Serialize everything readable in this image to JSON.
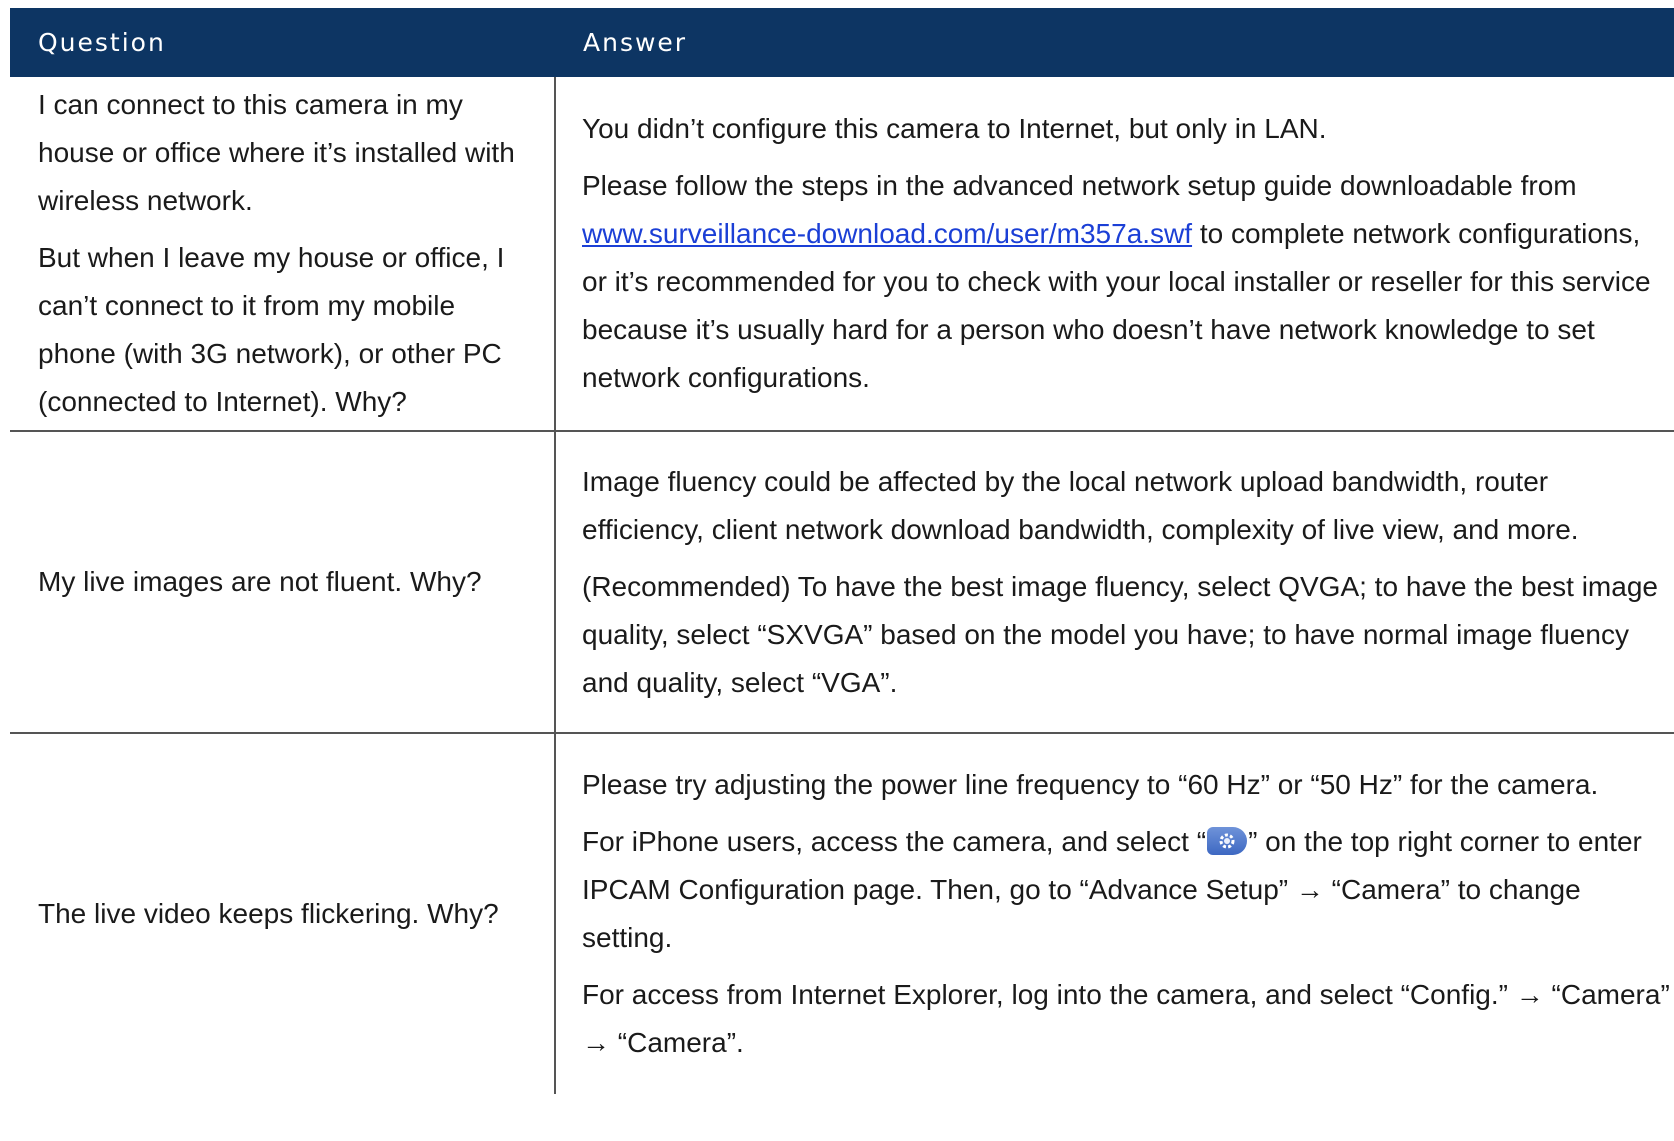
{
  "header": {
    "question": "Question",
    "answer": "Answer"
  },
  "rows": [
    {
      "question": [
        "I can connect to this camera in my house or office where it’s installed with wireless network.",
        "But when I leave my house or office, I can’t connect to it from my mobile phone (with 3G network), or other PC (connected to Internet). Why?"
      ],
      "answer_p1": "You didn’t configure this camera to Internet, but only in LAN.",
      "answer_p2_before": "Please follow the steps in the advanced network setup guide downloadable from ",
      "answer_p2_link": "www.surveillance-download.com/user/m357a.swf",
      "answer_p2_after": " to complete network configurations, or it’s recommended for you to check with your local installer or reseller for this service because it’s usually hard for a person who doesn’t have network knowledge to set network configurations."
    },
    {
      "question": "My live images are not fluent. Why?",
      "answer": [
        "Image fluency could be affected by the local network upload bandwidth, router efficiency, client network download bandwidth, complexity of live view, and more.",
        "(Recommended) To have the best image fluency, select QVGA; to have the best image quality, select “SXVGA” based on the model you have; to have normal image fluency and quality, select “VGA”."
      ]
    },
    {
      "question": "The live video keeps flickering. Why?",
      "answer_p1": "Please try adjusting the power line frequency to “60 Hz” or “50 Hz” for the camera.",
      "answer_p2_before": "For iPhone users, access the camera, and select “",
      "answer_p2_icon": "gear-icon",
      "answer_p2_after": "” on the top right corner to enter IPCAM Configuration page. Then, go to “Advance Setup” → “Camera” to change setting.",
      "answer_p3": "For access from Internet Explorer, log into the camera, and select “Config.” → “Camera” → “Camera”."
    }
  ],
  "colors": {
    "header_bg": "#0d3563",
    "link": "#1b3fd6"
  }
}
